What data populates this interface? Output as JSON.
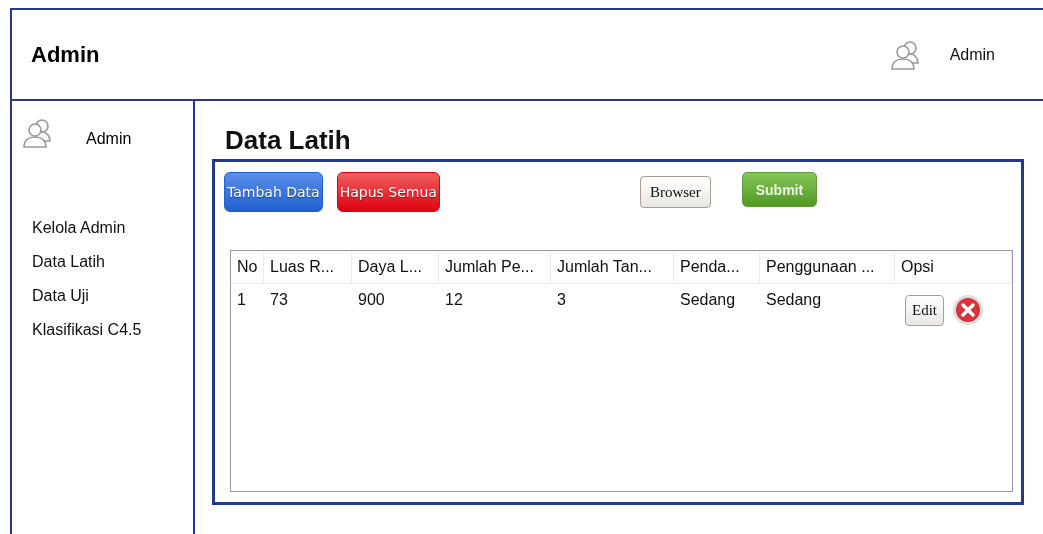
{
  "header": {
    "title": "Admin",
    "user": "Admin"
  },
  "sidebar": {
    "user": "Admin",
    "items": [
      {
        "label": "Kelola Admin"
      },
      {
        "label": "Data Latih"
      },
      {
        "label": "Data Uji"
      },
      {
        "label": "Klasifikasi C4.5"
      }
    ]
  },
  "page_title": "Data Latih",
  "toolbar": {
    "add_button": "Tambah Data",
    "delete_all_button": "Hapus Semua",
    "browse_button": "Browser",
    "submit_button": "Submit"
  },
  "table": {
    "columns": [
      "No",
      "Luas R...",
      "Daya L...",
      "Jumlah Pe...",
      "Jumlah Tan...",
      "Penda...",
      "Penggunaan ...",
      "Opsi"
    ],
    "rows": [
      {
        "cells": [
          "1",
          "73",
          "900",
          "12",
          "3",
          "Sedang",
          "Sedang"
        ],
        "edit_button": "Edit"
      }
    ]
  }
}
